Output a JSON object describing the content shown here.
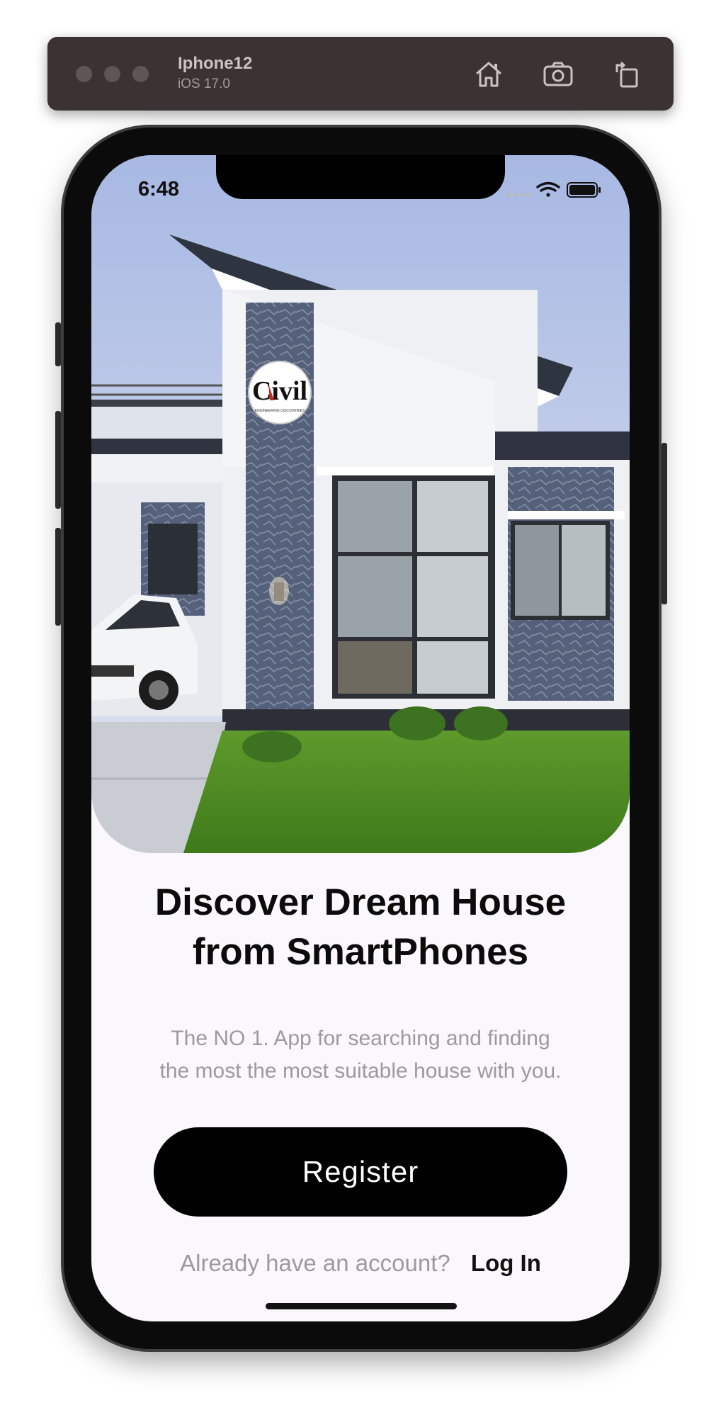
{
  "simulator": {
    "device_name": "Iphone12",
    "os_version": "iOS 17.0",
    "icons": [
      "home-icon",
      "screenshot-icon",
      "rotate-icon"
    ]
  },
  "status_bar": {
    "time": "6:48",
    "icons": [
      "signal-icon",
      "wifi-icon",
      "battery-icon"
    ]
  },
  "hero": {
    "logo_text": "Civil",
    "logo_subtext": "ENGINEERING DISCOVERIES"
  },
  "onboarding": {
    "title_line1": "Discover Dream House",
    "title_line2": "from SmartPhones",
    "subtitle_line1": "The NO 1. App for searching and finding",
    "subtitle_line2": "the most the most suitable house with you.",
    "register_label": "Register",
    "account_question": "Already have an account?",
    "login_label": "Log In"
  },
  "colors": {
    "primary_button": "#000000",
    "background": "#faf8fc",
    "muted_text": "#9b9b9b"
  }
}
